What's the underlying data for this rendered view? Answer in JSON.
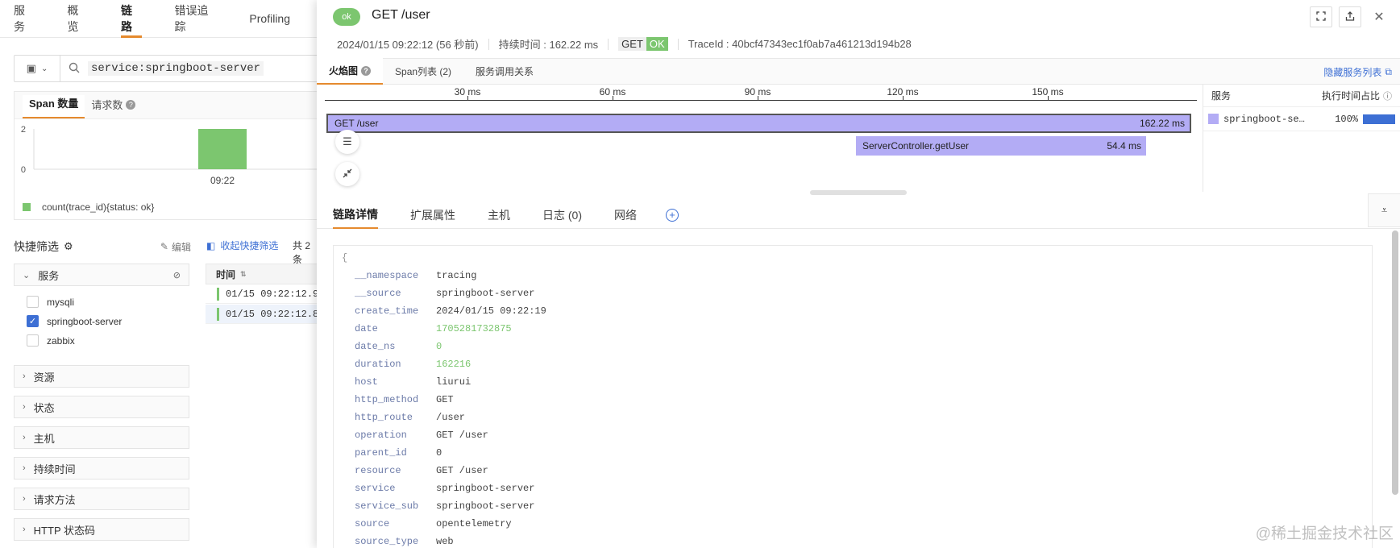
{
  "nav": [
    "服务",
    "概览",
    "链路",
    "错误追踪",
    "Profiling"
  ],
  "search": {
    "query": "service:springboot-server"
  },
  "chart_panel": {
    "tabs": [
      "Span 数量",
      "请求数"
    ],
    "legend": "count(trace_id){status: ok}"
  },
  "chart_data": {
    "type": "bar",
    "categories": [
      "09:22"
    ],
    "series": [
      {
        "name": "count(trace_id){status: ok}",
        "values": [
          2
        ]
      }
    ],
    "yticks": [
      "2",
      "0"
    ],
    "ylim": [
      0,
      2
    ],
    "color": "#7cc66f"
  },
  "quick_filter": {
    "title": "快捷筛选",
    "edit": "编辑",
    "collapse": "收起快捷筛选",
    "total": "共 2 条",
    "facets": {
      "service": {
        "label": "服务",
        "options": [
          "mysqli",
          "springboot-server",
          "zabbix"
        ],
        "checked": "springboot-server"
      },
      "others": [
        "资源",
        "状态",
        "主机",
        "持续时间",
        "请求方法",
        "HTTP 状态码"
      ]
    }
  },
  "list": {
    "header": "时间",
    "rows": [
      "01/15 09:22:12.9",
      "01/15 09:22:12.8"
    ]
  },
  "drawer": {
    "status_badge": "ok",
    "title": "GET /user",
    "time": "2024/01/15 09:22:12 (56 秒前)",
    "duration": "持续时间 : 162.22 ms",
    "method": "GET",
    "status": "OK",
    "trace_id": "TraceId : 40bcf47343ec1f0ab7a461213d194b28",
    "subtabs": [
      "火焰图",
      "Span列表 (2)",
      "服务调用关系"
    ],
    "hide_services": "隐藏服务列表",
    "axis_ticks": [
      "30 ms",
      "60 ms",
      "90 ms",
      "120 ms",
      "150 ms"
    ],
    "spans": [
      {
        "name": "GET /user",
        "duration": "162.22 ms"
      },
      {
        "name": "ServerController.getUser",
        "duration": "54.4 ms"
      }
    ],
    "service_panel": {
      "col_service": "服务",
      "col_pct": "执行时间占比",
      "row": {
        "name": "springboot-se…",
        "pct": "100%"
      }
    },
    "detail_tabs": [
      "链路详情",
      "扩展属性",
      "主机",
      "日志 (0)",
      "网络"
    ],
    "attributes": [
      {
        "k": "__namespace",
        "v": "tracing"
      },
      {
        "k": "__source",
        "v": "springboot-server"
      },
      {
        "k": "create_time",
        "v": "2024/01/15 09:22:19"
      },
      {
        "k": "date",
        "v": "1705281732875",
        "num": true
      },
      {
        "k": "date_ns",
        "v": "0",
        "num": true
      },
      {
        "k": "duration",
        "v": "162216",
        "num": true
      },
      {
        "k": "host",
        "v": "liurui"
      },
      {
        "k": "http_method",
        "v": "GET"
      },
      {
        "k": "http_route",
        "v": "/user"
      },
      {
        "k": "operation",
        "v": "GET /user"
      },
      {
        "k": "parent_id",
        "v": "0"
      },
      {
        "k": "resource",
        "v": "GET /user"
      },
      {
        "k": "service",
        "v": "springboot-server"
      },
      {
        "k": "service_sub",
        "v": "springboot-server"
      },
      {
        "k": "source",
        "v": "opentelemetry"
      },
      {
        "k": "source_type",
        "v": "web"
      }
    ]
  },
  "watermark": "@稀土掘金技术社区"
}
